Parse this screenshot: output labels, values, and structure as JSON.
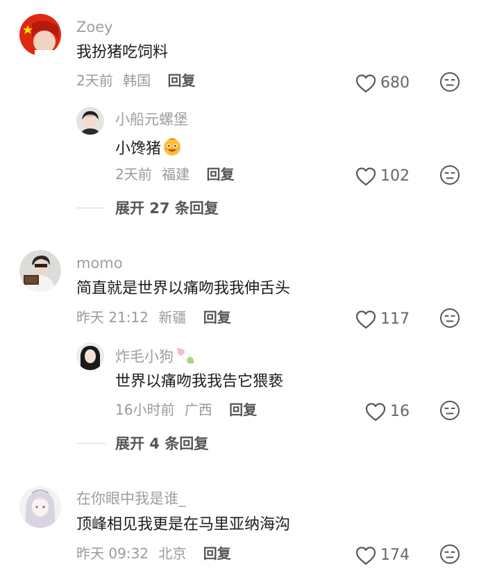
{
  "comments": [
    {
      "username": "Zoey",
      "text": "我扮猪吃饲料",
      "time": "2天前",
      "location": "韩国",
      "reply_label": "回复",
      "likes": "680",
      "replies": [
        {
          "username": "小船元螺堡",
          "text": "小馋猪",
          "emoji": "drooling-face-emoji",
          "time": "2天前",
          "location": "福建",
          "reply_label": "回复",
          "likes": "102"
        }
      ],
      "expand_label": "展开 27 条回复"
    },
    {
      "username": "momo",
      "text": "简直就是世界以痛吻我我伸舌头",
      "time": "昨天 21:12",
      "location": "新疆",
      "reply_label": "回复",
      "likes": "117",
      "replies": [
        {
          "username": "炸毛小狗",
          "name_emoji": "dango-emoji",
          "text": "世界以痛吻我我告它猥亵",
          "time": "16小时前",
          "location": "广西",
          "reply_label": "回复",
          "likes": "16"
        }
      ],
      "expand_label": "展开 4 条回复"
    },
    {
      "username": "在你眼中我是谁_",
      "text": "顶峰相见我更是在马里亚纳海沟",
      "time": "昨天 09:32",
      "location": "北京",
      "reply_label": "回复",
      "likes": "174"
    }
  ],
  "icons": {
    "like": "heart-outline-icon",
    "dislike": "unamused-face-icon"
  },
  "colors": {
    "username": "#9e9e9e",
    "text": "#1c1c1c",
    "meta": "#9a9a9a",
    "reply": "#555555",
    "flag_red": "#de2910"
  }
}
